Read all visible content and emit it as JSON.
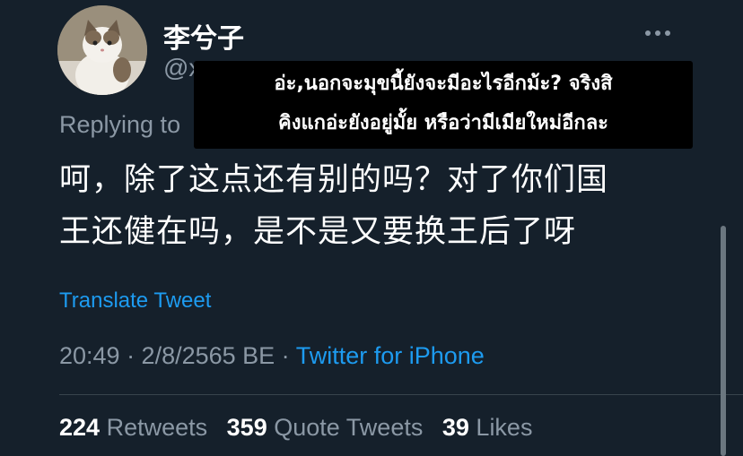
{
  "user": {
    "display_name": "李兮子",
    "handle": "@x"
  },
  "overlay_caption": {
    "line1": "อ่ะ,นอกจะมุขนี้ยังจะมีอะไรอีกม้ะ? จริงสิ",
    "line2": "คิงแกอ่ะยังอยู่มั้ย หรือว่ามีเมียใหม่อีกละ"
  },
  "replying_to": "Replying to",
  "tweet": {
    "line1": "呵，除了这点还有别的吗？对了你们国",
    "line2": "王还健在吗，是不是又要换王后了呀"
  },
  "translate_label": "Translate Tweet",
  "meta": {
    "timestamp": "20:49 · 2/8/2565 BE · ",
    "source": "Twitter for iPhone"
  },
  "stats": {
    "retweets_count": "224",
    "retweets_label": "Retweets",
    "quotes_count": "359",
    "quotes_label": "Quote Tweets",
    "likes_count": "39",
    "likes_label": "Likes"
  },
  "icons": {
    "more": "more-options-icon",
    "avatar": "cat-avatar"
  },
  "colors": {
    "background": "#15202b",
    "link": "#1d9bf0",
    "secondary_text": "#8b98a5"
  }
}
